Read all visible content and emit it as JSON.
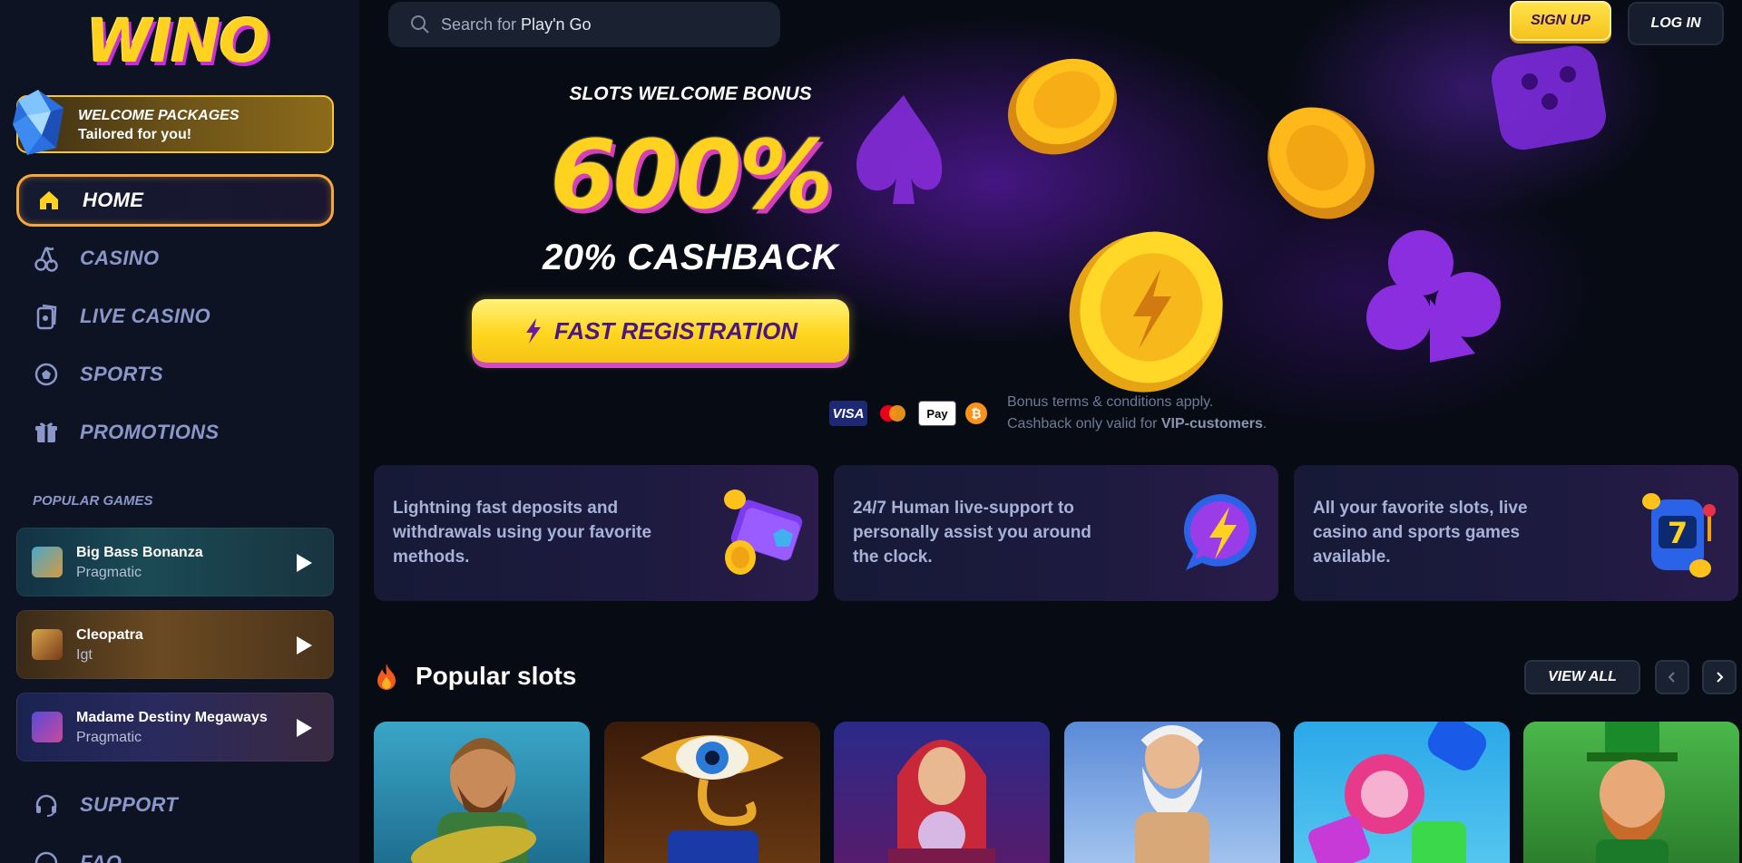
{
  "brand": {
    "logo_text": "WINO",
    "accent": "#ffd21f",
    "accent_shadow": "#c62fd8"
  },
  "sidebar": {
    "welcome": {
      "title": "WELCOME PACKAGES",
      "subtitle": "Tailored for you!"
    },
    "nav": [
      {
        "label": "HOME",
        "icon": "home-icon",
        "active": true
      },
      {
        "label": "CASINO",
        "icon": "cherry-icon",
        "active": false
      },
      {
        "label": "LIVE CASINO",
        "icon": "cards-icon",
        "active": false
      },
      {
        "label": "SPORTS",
        "icon": "soccer-ball-icon",
        "active": false
      },
      {
        "label": "PROMOTIONS",
        "icon": "gift-icon",
        "active": false
      }
    ],
    "popular_title": "POPULAR GAMES",
    "popular_games": [
      {
        "name": "Big Bass Bonanza",
        "provider": "Pragmatic"
      },
      {
        "name": "Cleopatra",
        "provider": "Igt"
      },
      {
        "name": "Madame Destiny Megaways",
        "provider": "Pragmatic"
      }
    ],
    "support": {
      "label": "SUPPORT"
    },
    "faq": {
      "label": "FAQ"
    }
  },
  "header": {
    "search": {
      "prefix": "Search for ",
      "highlight": "Play'n Go"
    },
    "signup_label": "SIGN UP",
    "login_label": "LOG IN"
  },
  "hero": {
    "kicker": "SLOTS WELCOME BONUS",
    "percent": "600%",
    "cashback": "20% CASHBACK",
    "cta_label": "FAST REGISTRATION",
    "payments": [
      "VISA",
      "Mastercard",
      "Apple Pay",
      "Bitcoin"
    ],
    "terms_line1": "Bonus terms & conditions apply.",
    "terms_line2_prefix": "Cashback only valid for ",
    "terms_line2_bold": "VIP-customers",
    "terms_line2_suffix": "."
  },
  "features": [
    {
      "text": "Lightning fast deposits and withdrawals using your favorite methods.",
      "icon": "wallet-coins-icon"
    },
    {
      "text": "24/7 Human live-support to personally assist you around the clock.",
      "icon": "lightning-chat-icon"
    },
    {
      "text": "All your favorite slots, live casino and sports games available.",
      "icon": "slot-machine-icon"
    }
  ],
  "popular_slots": {
    "title": "Popular slots",
    "view_all_label": "VIEW ALL",
    "tiles": [
      "fisherman",
      "eye-of-horus",
      "fortune-teller",
      "zeus",
      "candy",
      "leprechaun"
    ]
  }
}
